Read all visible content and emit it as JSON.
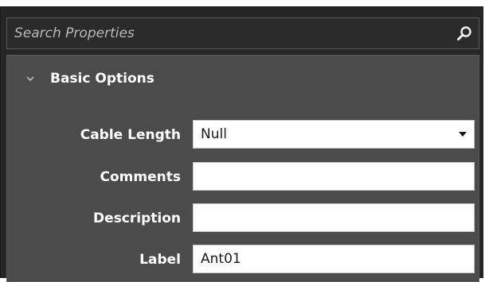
{
  "search": {
    "placeholder": "Search Properties",
    "icon": "search-icon"
  },
  "section": {
    "title": "Basic Options",
    "expanded": true,
    "icon": "chevron-down-icon"
  },
  "fields": [
    {
      "label": "Cable Length",
      "type": "select",
      "value": "Null"
    },
    {
      "label": "Comments",
      "type": "text",
      "value": ""
    },
    {
      "label": "Description",
      "type": "text",
      "value": ""
    },
    {
      "label": "Label",
      "type": "text",
      "value": "Ant01"
    }
  ],
  "colors": {
    "panel_background": "#262626",
    "content_background": "#4b4b4b",
    "field_background": "#ffffff",
    "label_text": "#ffffff"
  }
}
